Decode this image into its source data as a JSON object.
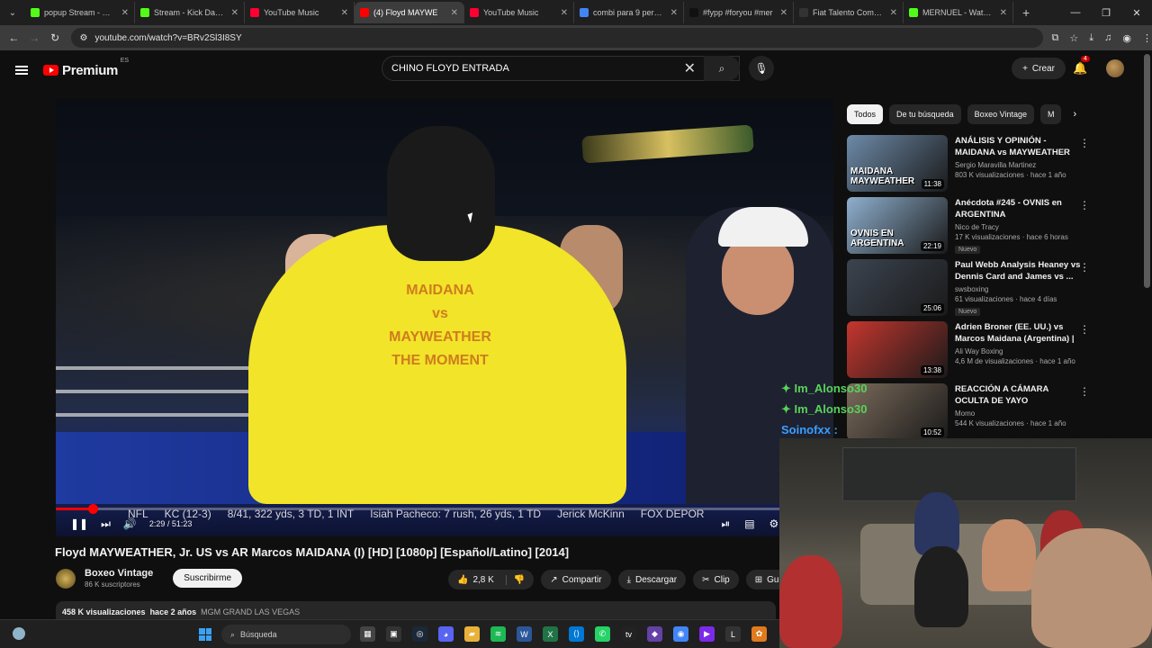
{
  "browser": {
    "tabs": [
      {
        "title": "popup Stream - Watc",
        "fav": "#53fc18"
      },
      {
        "title": "Stream - Kick Dashbo",
        "fav": "#53fc18"
      },
      {
        "title": "YouTube Music",
        "fav": "#ff0033"
      },
      {
        "title": "(4) Floyd MAYWE",
        "fav": "#ff0000",
        "active": true
      },
      {
        "title": "YouTube Music",
        "fav": "#ff0033"
      },
      {
        "title": "combi para 9 person",
        "fav": "#4285f4"
      },
      {
        "title": "#fypp #foryou #mer",
        "fav": "#111111"
      },
      {
        "title": "Fiat Talento Combi M",
        "fav": "#333333"
      },
      {
        "title": "MERNUEL - Watch cl",
        "fav": "#53fc18"
      }
    ],
    "url": "youtube.com/watch?v=BRv2Sl3I8SY"
  },
  "header": {
    "logo": "Premium",
    "region": "ES",
    "search_query": "CHINO FLOYD ENTRADA",
    "create_label": "Crear",
    "notif_count": "4"
  },
  "player": {
    "time": "2:29 / 51:23",
    "progress": 0.048,
    "shirt_text": "MAIDANA\nvs\nMAYWEATHER\nTHE MOMENT",
    "score_items": [
      "NFL",
      "KC (12-3)",
      "8/41, 322 yds, 3 TD, 1 INT",
      "Isiah Pacheco: 7 rush, 26 yds, 1 TD",
      "Jerick McKinn",
      "FOX DEPOR"
    ]
  },
  "video": {
    "title": "Floyd MAYWEATHER, Jr. US vs AR Marcos MAIDANA (I) [HD] [1080p] [Español/Latino] [2014]",
    "channel": "Boxeo Vintage",
    "subscribers": "86 K suscriptores",
    "subscribe_label": "Suscribirme",
    "likes": "2,8 K",
    "share_label": "Compartir",
    "download_label": "Descargar",
    "clip_label": "Clip",
    "save_label": "Gu",
    "views": "458 K visualizaciones",
    "age": "hace 2 años",
    "location": "MGM GRAND LAS VEGAS"
  },
  "chips": [
    "Todos",
    "De tu búsqueda",
    "Boxeo Vintage",
    "M"
  ],
  "recommendations": [
    {
      "title": "ANÁLISIS Y OPINIÓN - MAIDANA vs MAYWEATHER",
      "channel": "Sergio Maravilla Martinez",
      "meta": "803 K visualizaciones · hace 1 año",
      "duration": "11:38",
      "thumb_caption": "MAIDANA MAYWEATHER",
      "badge": "",
      "thumb_color": "#6d8aa8"
    },
    {
      "title": "Anécdota #245 - OVNIS en ARGENTINA",
      "channel": "Nico de Tracy",
      "meta": "17 K visualizaciones · hace 6 horas",
      "duration": "22:19",
      "thumb_caption": "OVNIS EN ARGENTINA",
      "badge": "Nuevo",
      "thumb_color": "#8fb0cf"
    },
    {
      "title": "Paul Webb Analysis Heaney vs Dennis Card and James vs ...",
      "channel": "swsboxing",
      "meta": "61 visualizaciones · hace 4 días",
      "duration": "25:06",
      "thumb_caption": "",
      "badge": "Nuevo",
      "thumb_color": "#3b4450"
    },
    {
      "title": "Adrien Broner (EE. UU.) vs Marcos Maidana (Argentina) | ...",
      "channel": "Ali Way Boxing",
      "meta": "4,6 M de visualizaciones · hace 1 año",
      "duration": "13:38",
      "thumb_caption": "",
      "badge": "",
      "thumb_color": "#c5362e"
    },
    {
      "title": "REACCIÓN A CÁMARA OCULTA DE YAYO",
      "channel": "Momo",
      "meta": "544 K visualizaciones · hace 1 año",
      "duration": "10:52",
      "thumb_caption": "",
      "badge": "",
      "thumb_color": "#7a6a5a"
    }
  ],
  "chat": [
    "Im_Alonso30",
    "Im_Alonso30",
    "Soinofxx :"
  ],
  "taskbar": {
    "search_placeholder": "Búsqueda"
  }
}
